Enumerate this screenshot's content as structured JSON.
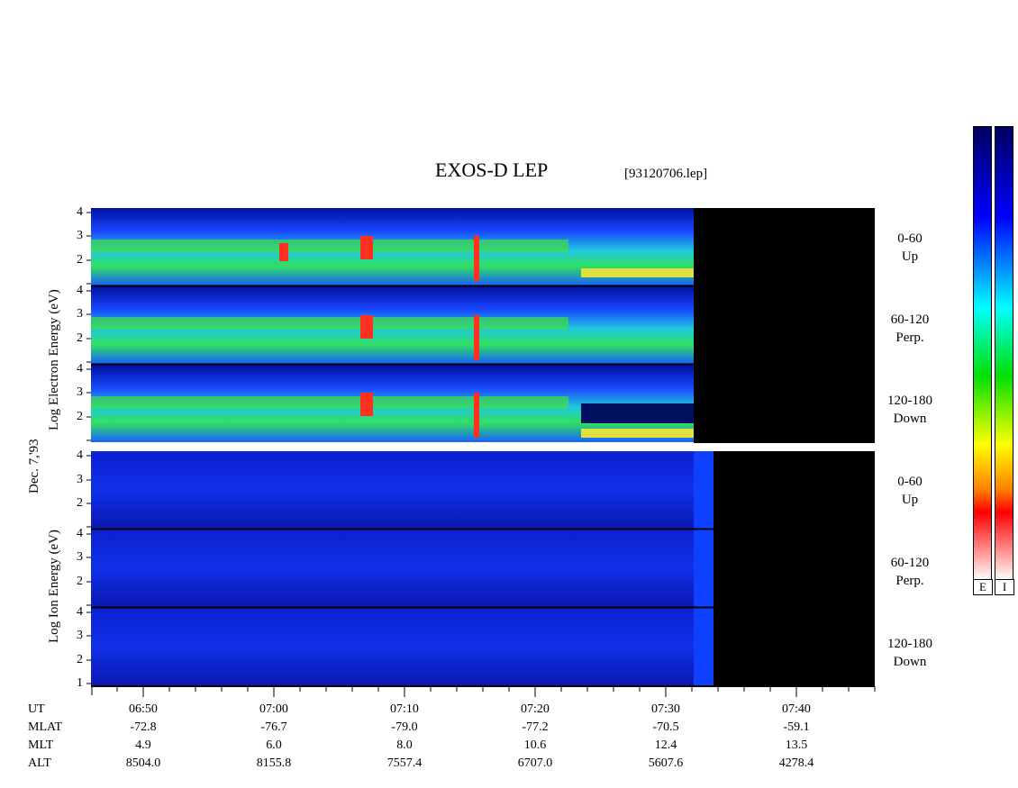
{
  "header": {
    "title": "EXOS-D LEP",
    "file": "[93120706.lep]"
  },
  "date_label": "Dec. 7,'93",
  "electron_panels": {
    "ylabel": "Log Electron Energy (eV)",
    "angles": [
      {
        "range": "0-60",
        "dir": "Up"
      },
      {
        "range": "60-120",
        "dir": "Perp."
      },
      {
        "range": "120-180",
        "dir": "Down"
      }
    ]
  },
  "ion_panels": {
    "ylabel": "Log Ion Energy (eV)",
    "angles": [
      {
        "range": "0-60",
        "dir": "Up"
      },
      {
        "range": "60-120",
        "dir": "Perp."
      },
      {
        "range": "120-180",
        "dir": "Down"
      }
    ]
  },
  "yticks": [
    "4",
    "3",
    "2"
  ],
  "yticks_bottom": [
    "4",
    "3",
    "2",
    "1"
  ],
  "time_axis": {
    "rows": [
      {
        "label": "UT",
        "values": [
          "06:50",
          "07:00",
          "07:10",
          "07:20",
          "07:30",
          "07:40"
        ]
      },
      {
        "label": "MLAT",
        "values": [
          "-72.8",
          "-76.7",
          "-79.0",
          "-77.2",
          "-70.5",
          "-59.1"
        ]
      },
      {
        "label": "MLT",
        "values": [
          "4.9",
          "6.0",
          "8.0",
          "10.6",
          "12.4",
          "13.5"
        ]
      },
      {
        "label": "ALT",
        "values": [
          "8504.0",
          "8155.8",
          "7557.4",
          "6707.0",
          "5607.6",
          "4278.4"
        ]
      }
    ]
  },
  "colorbars": [
    {
      "label": "E"
    },
    {
      "label": "I"
    }
  ],
  "colors": {
    "background_high": "#000066",
    "mid": "#00ffff",
    "low": "#ffffff"
  },
  "chart_data": {
    "type": "heatmap",
    "title": "EXOS-D LEP",
    "xlabel": "UT",
    "x_ticks": [
      "06:50",
      "07:00",
      "07:10",
      "07:20",
      "07:30",
      "07:40"
    ],
    "ylim": [
      1,
      4
    ],
    "y_scale": "log energy (eV)",
    "series": [
      {
        "name": "Electron 0-60 Up",
        "data_end": "07:31"
      },
      {
        "name": "Electron 60-120 Perp.",
        "data_end": "07:31"
      },
      {
        "name": "Electron 120-180 Down",
        "data_end": "07:31"
      },
      {
        "name": "Ion 0-60 Up",
        "data_end": "07:32"
      },
      {
        "name": "Ion 60-120 Perp.",
        "data_end": "07:32"
      },
      {
        "name": "Ion 120-180 Down",
        "data_end": "07:32"
      }
    ]
  }
}
